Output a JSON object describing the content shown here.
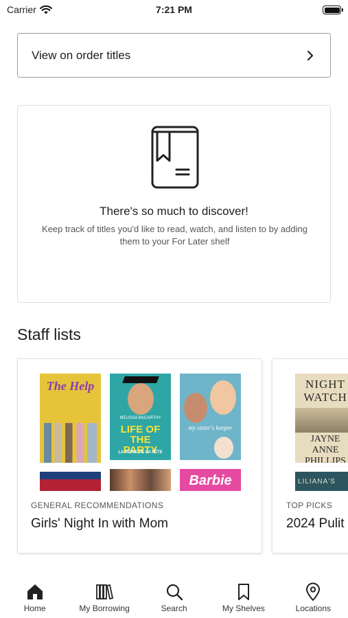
{
  "status_bar": {
    "carrier": "Carrier",
    "time": "7:21 PM"
  },
  "on_order": {
    "label": "View on order titles"
  },
  "empty_state": {
    "title": "There's so much to discover!",
    "message": "Keep track of titles you'd like to read, watch, and listen to by adding them to your For Later shelf"
  },
  "staff_lists": {
    "heading": "Staff lists",
    "cards": [
      {
        "category": "GENERAL RECOMMENDATIONS",
        "title": "Girls' Night In with Mom",
        "covers": [
          {
            "text": "The Help"
          },
          {
            "top": "MELISSA McCARTHY",
            "text": "LIFE OF THE PARTY",
            "sub": "LA REINE DE LA FÊTE"
          },
          {
            "text": "my sister's keeper"
          },
          {
            "text": ""
          },
          {
            "text": ""
          },
          {
            "text": "Barbie"
          }
        ]
      },
      {
        "category": "TOP PICKS",
        "title": "2024 Pulit",
        "covers": [
          {
            "text": "NIGHT WATCH",
            "sub": "JAYNE ANNE PHILLIPS"
          },
          {
            "text": "LILIANA'S"
          }
        ]
      }
    ]
  },
  "tabs": [
    {
      "label": "Home",
      "icon": "home-icon"
    },
    {
      "label": "My Borrowing",
      "icon": "books-icon"
    },
    {
      "label": "Search",
      "icon": "search-icon"
    },
    {
      "label": "My Shelves",
      "icon": "bookmark-icon"
    },
    {
      "label": "Locations",
      "icon": "location-pin-icon"
    }
  ],
  "colors": {
    "accent_text": "#1d1d1d",
    "border": "#9a9a9a",
    "help_cover": "#e6c43a",
    "party_cover": "#2ea6a6"
  }
}
